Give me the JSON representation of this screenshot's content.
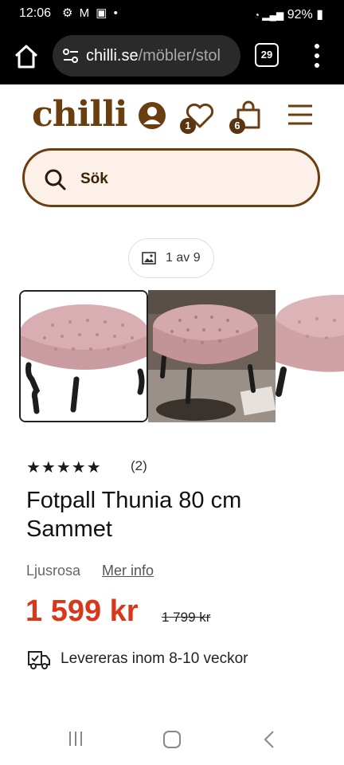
{
  "status": {
    "time": "12:06",
    "battery": "92%"
  },
  "browser": {
    "url_host": "chilli.se",
    "url_path": "/möbler/stol",
    "tab_count": "29"
  },
  "site": {
    "logo": "chilli",
    "wishlist_count": "1",
    "cart_count": "6"
  },
  "search": {
    "placeholder": "Sök"
  },
  "gallery": {
    "counter": "1 av 9"
  },
  "product": {
    "rating_stars": "★★★★★",
    "review_count": "(2)",
    "title": "Fotpall Thunia 80 cm Sammet",
    "color": "Ljusrosa",
    "more_info": "Mer info",
    "price": "1 599 kr",
    "old_price": "1 799 kr",
    "delivery": "Levereras inom 8-10 veckor"
  },
  "colors": {
    "brand_brown": "#6b3e12",
    "price_red": "#d9361a",
    "search_bg": "#fdf0e8"
  },
  "icons": [
    "home-icon",
    "tune-icon",
    "kebab-menu-icon",
    "user-icon",
    "heart-icon",
    "cart-icon",
    "hamburger-icon",
    "search-icon",
    "image-icon",
    "truck-icon"
  ]
}
